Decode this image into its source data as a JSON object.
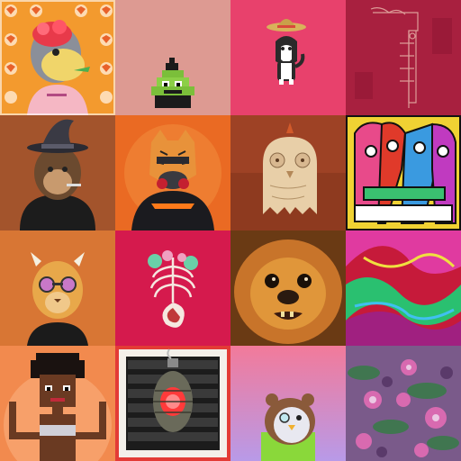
{
  "gallery": {
    "columns": 4,
    "rows": 4,
    "tiles": [
      {
        "subject": "ape-with-flower-hat-on-fox-pattern",
        "bg": "#f39a2e"
      },
      {
        "subject": "pixel-poop-wizard",
        "bg": "#dd9a92"
      },
      {
        "subject": "husky-with-sombrero",
        "bg": "#e8416c"
      },
      {
        "subject": "abstract-sketch-tool",
        "bg": "#a8203f"
      },
      {
        "subject": "ape-with-witch-hat",
        "bg": "#a3542c"
      },
      {
        "subject": "tiger-with-gas-mask",
        "bg": "#ea6a23"
      },
      {
        "subject": "ghost-owl-creature",
        "bg": "#8e3a1f"
      },
      {
        "subject": "colorful-cubist-faces",
        "bg": "#f0d233"
      },
      {
        "subject": "lion-with-sunglasses",
        "bg": "#d87634"
      },
      {
        "subject": "floral-skeleton-ribcage",
        "bg": "#d51a4d"
      },
      {
        "subject": "pekingese-dog-photo",
        "bg": "#6a3a14"
      },
      {
        "subject": "psychedelic-abstract",
        "bg": "#c61a3a"
      },
      {
        "subject": "pixel-girl-afro",
        "bg": "#f28a4e"
      },
      {
        "subject": "feel-good-grenade",
        "bg": "#e33b36"
      },
      {
        "subject": "bear-penguin-character",
        "bg": "#e58a9c"
      },
      {
        "subject": "flowers-closeup",
        "bg": "#7a5a8a"
      }
    ]
  },
  "colors": {
    "orange": "#f39a2e",
    "pink": "#e8416c",
    "red": "#d51a4d"
  }
}
